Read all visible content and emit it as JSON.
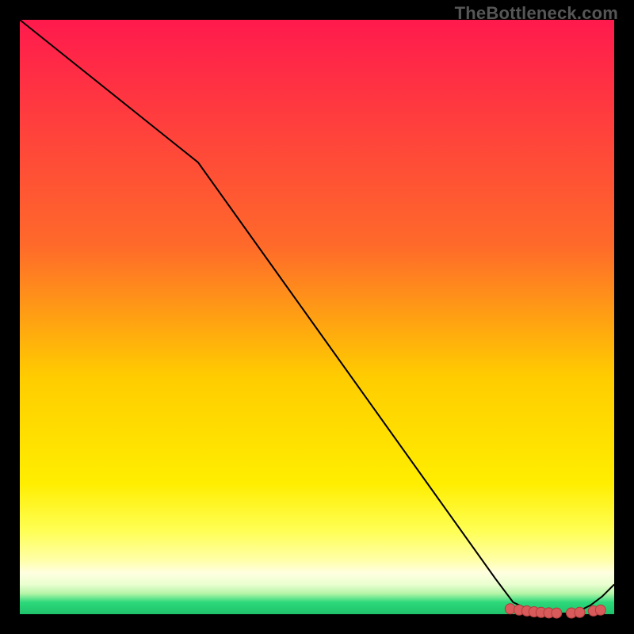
{
  "watermark": "TheBottleneck.com",
  "colors": {
    "frame_bg": "#000000",
    "grad_top": "#ff1a4d",
    "grad_mid": "#ffcc00",
    "grad_low": "#ffff33",
    "grad_pale": "#ffffcc",
    "grad_bottom": "#2cd97b",
    "curve": "#000000",
    "marker_fill": "#d85a5a",
    "marker_stroke": "#af3c3c"
  },
  "chart_data": {
    "type": "line",
    "title": "",
    "xlabel": "",
    "ylabel": "",
    "xlim": [
      0,
      100
    ],
    "ylim": [
      0,
      100
    ],
    "grid": false,
    "legend": false,
    "series": [
      {
        "name": "bottleneck-curve",
        "x": [
          0,
          5,
          10,
          15,
          20,
          25,
          30,
          35,
          40,
          45,
          50,
          55,
          60,
          65,
          70,
          75,
          80,
          83,
          86,
          88,
          90,
          92,
          94,
          96,
          98,
          100
        ],
        "y": [
          100,
          96,
          92,
          88,
          84,
          80,
          76,
          69,
          62,
          55,
          48,
          41,
          34,
          27,
          20,
          13,
          6,
          2,
          0.6,
          0.2,
          0.1,
          0.15,
          0.5,
          1.5,
          3.0,
          5.0
        ]
      }
    ],
    "markers": {
      "name": "optimal-markers",
      "x": [
        82.5,
        84.0,
        85.3,
        86.5,
        87.7,
        89.0,
        90.3,
        92.8,
        94.2,
        96.5,
        97.7
      ],
      "y": [
        0.9,
        0.7,
        0.55,
        0.4,
        0.3,
        0.22,
        0.18,
        0.2,
        0.3,
        0.55,
        0.7
      ]
    },
    "gradient_bands_y": [
      0,
      76,
      86,
      92,
      94.5,
      96.5,
      98.2,
      100
    ],
    "gradient_bands_color_keys": [
      "grad_top",
      "grad_mid",
      "grad_low",
      "grad_pale",
      "grad_pale",
      "grad_bottom",
      "grad_bottom"
    ]
  }
}
